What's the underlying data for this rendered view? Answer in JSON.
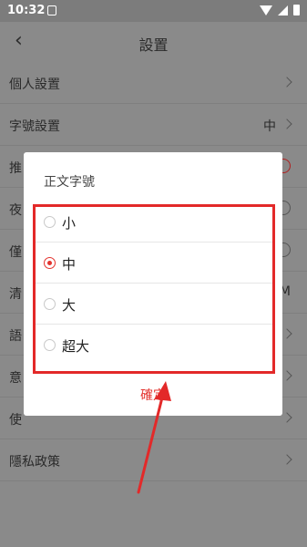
{
  "status_bar": {
    "time": "10:32"
  },
  "nav": {
    "title": "設置"
  },
  "settings": {
    "items": [
      {
        "label": "個人設置"
      },
      {
        "label": "字號設置",
        "value": "中"
      },
      {
        "label": "推"
      },
      {
        "label": "夜"
      },
      {
        "label": "僅"
      },
      {
        "label": "清",
        "value": "M"
      },
      {
        "label": "語"
      },
      {
        "label": "意"
      },
      {
        "label": "使"
      },
      {
        "label": "隱私政策"
      }
    ]
  },
  "dialog": {
    "title": "正文字號",
    "options": [
      {
        "label": "小",
        "selected": false
      },
      {
        "label": "中",
        "selected": true
      },
      {
        "label": "大",
        "selected": false
      },
      {
        "label": "超大",
        "selected": false
      }
    ],
    "confirm_label": "確定"
  },
  "colors": {
    "accent": "#e3342f",
    "overlay": "#8a8a8a",
    "annotation": "#e32929"
  }
}
